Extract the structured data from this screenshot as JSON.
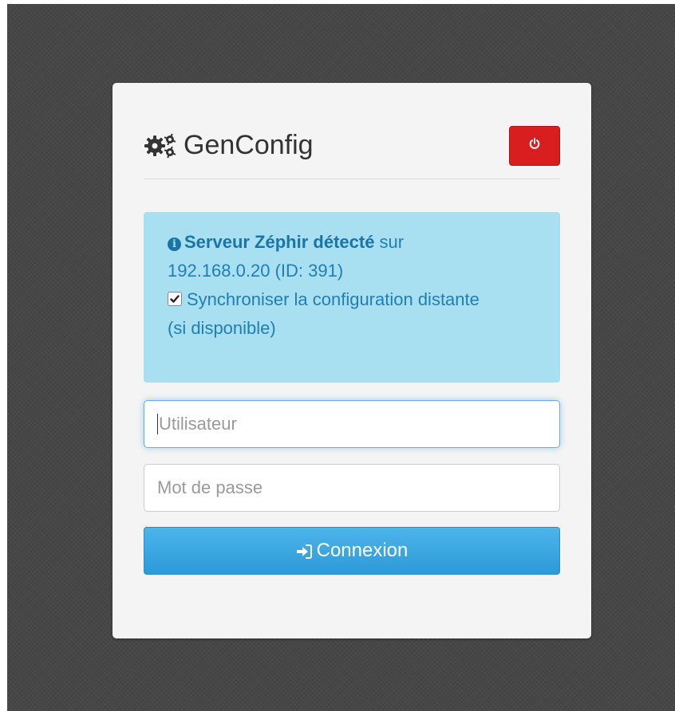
{
  "colors": {
    "backdrop": "#474747",
    "card": "#f4f4f4",
    "danger": "#d81e1e",
    "info_bg": "#a8dff1",
    "info_text": "#1f7fb4",
    "primary": "#2b9ad8",
    "focus": "#66afe9"
  },
  "app": {
    "title": "GenConfig",
    "brand_icon": "cogs-icon",
    "power_icon": "power-icon"
  },
  "alert": {
    "icon": "info-circle-icon",
    "server_label": "Serveur Zéphir détecté",
    "server_suffix": " sur",
    "server_address": "192.168.0.20 (ID: 391)",
    "sync_checked": true,
    "sync_label": "Synchroniser la configuration distante",
    "sync_note": "(si disponible)"
  },
  "login": {
    "username_placeholder": "Utilisateur",
    "password_placeholder": "Mot de passe",
    "submit_label": "Connexion",
    "submit_icon": "sign-in-icon"
  }
}
